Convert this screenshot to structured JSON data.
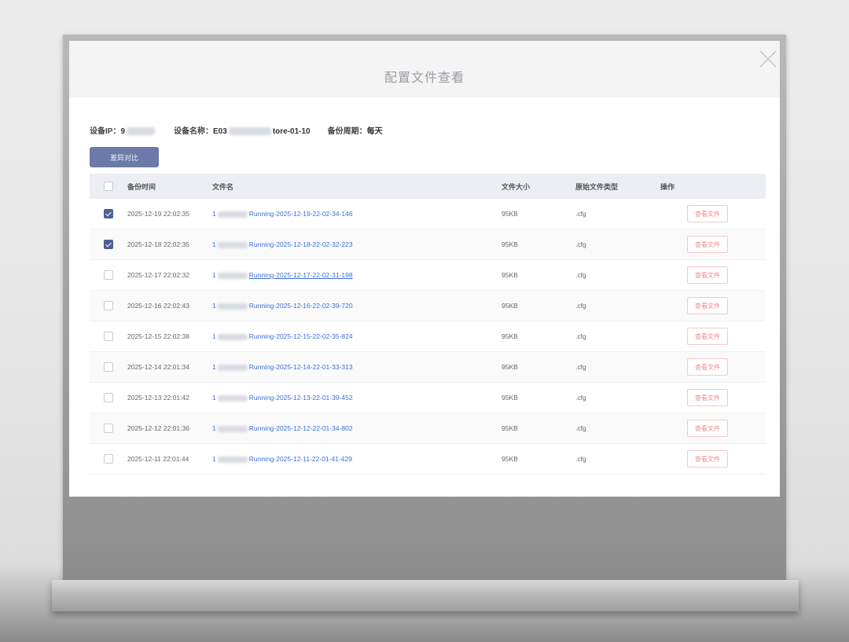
{
  "dialog": {
    "title": "配置文件查看"
  },
  "info": {
    "ip_label": "设备IP：",
    "ip_value": "9",
    "name_label": "设备名称：",
    "name_prefix": "E03",
    "name_suffix": "tore-01-10",
    "cycle_label": "备份周期：",
    "cycle_value": "每天"
  },
  "toolbar": {
    "diff_label": "差异对比"
  },
  "table": {
    "headers": {
      "time": "备份时间",
      "name": "文件名",
      "size": "文件大小",
      "type": "原始文件类型",
      "op": "操作"
    },
    "view_label": "查看文件",
    "rows": [
      {
        "checked": true,
        "time": "2025-12-19 22:02:35",
        "prefix": "1",
        "name": "Running-2025-12-19-22-02-34-146",
        "size": "95KB",
        "type": ".cfg"
      },
      {
        "checked": true,
        "time": "2025-12-18 22:02:35",
        "prefix": "1",
        "name": "Running-2025-12-18-22-02-32-223",
        "size": "95KB",
        "type": ".cfg"
      },
      {
        "checked": false,
        "time": "2025-12-17 22:02:32",
        "prefix": "1",
        "name": "Running-2025-12-17-22-02-31-198",
        "size": "95KB",
        "type": ".cfg"
      },
      {
        "checked": false,
        "time": "2025-12-16 22:02:43",
        "prefix": "1",
        "name": "Running-2025-12-16-22-02-39-720",
        "size": "95KB",
        "type": ".cfg"
      },
      {
        "checked": false,
        "time": "2025-12-15 22:02:38",
        "prefix": "1",
        "name": "Running-2025-12-15-22-02-35-824",
        "size": "95KB",
        "type": ".cfg"
      },
      {
        "checked": false,
        "time": "2025-12-14 22:01:34",
        "prefix": "1",
        "name": "Running-2025-12-14-22-01-33-313",
        "size": "95KB",
        "type": ".cfg"
      },
      {
        "checked": false,
        "time": "2025-12-13 22:01:42",
        "prefix": "1",
        "name": "Running-2025-12-13-22-01-39-452",
        "size": "95KB",
        "type": ".cfg"
      },
      {
        "checked": false,
        "time": "2025-12-12 22:01:36",
        "prefix": "1",
        "name": "Running-2025-12-12-22-01-34-802",
        "size": "95KB",
        "type": ".cfg"
      },
      {
        "checked": false,
        "time": "2025-12-11 22:01:44",
        "prefix": "1",
        "name": "Running-2025-12-11-22-01-41-429",
        "size": "95KB",
        "type": ".cfg"
      }
    ]
  },
  "colors": {
    "accent": "#4f5f92",
    "link": "#3a6fd8",
    "danger": "#ef8b8b"
  }
}
